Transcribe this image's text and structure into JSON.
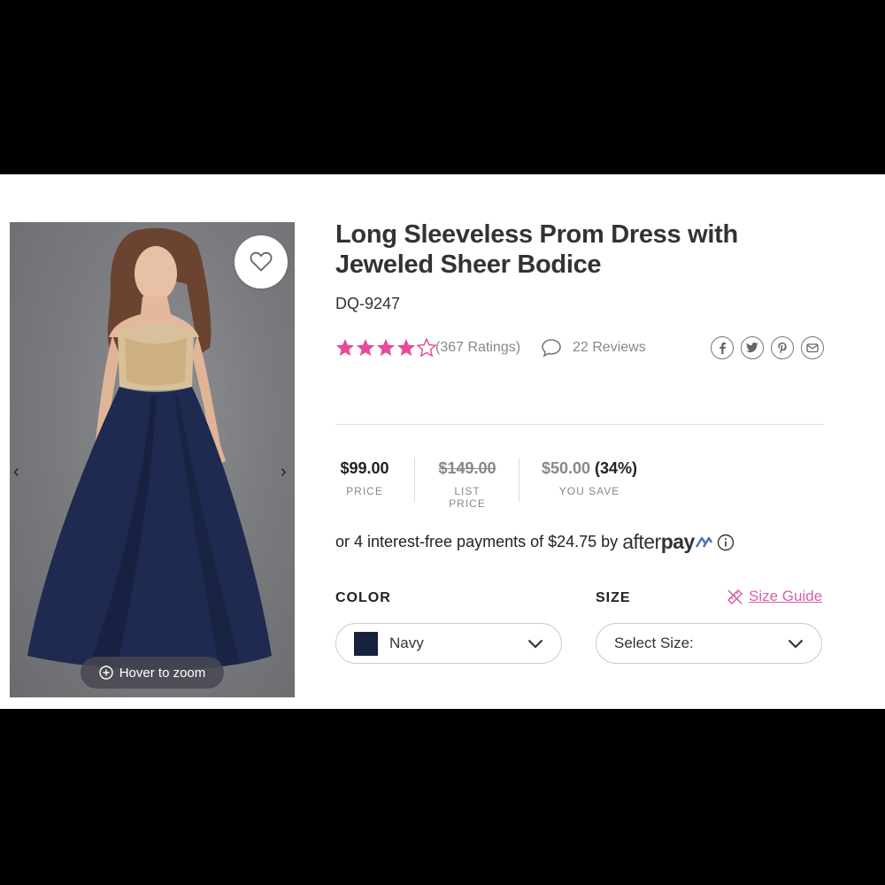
{
  "product": {
    "title": "Long Sleeveless Prom Dress with Jeweled Sheer Bodice",
    "sku": "DQ-9247",
    "rating": 4,
    "ratings_text": "(367 Ratings)",
    "reviews_text": "22 Reviews"
  },
  "gallery": {
    "zoom_label": "Hover to zoom",
    "prev_glyph": "‹",
    "next_glyph": "›"
  },
  "share": [
    "facebook-icon",
    "twitter-icon",
    "pinterest-icon",
    "email-icon"
  ],
  "pricing": {
    "price": "$99.00",
    "price_label": "PRICE",
    "list_price": "$149.00",
    "list_label": "LIST PRICE",
    "save_amount": "$50.00",
    "save_percent": "(34%)",
    "save_label": "YOU SAVE"
  },
  "afterpay": {
    "text": "or 4 interest-free payments of $24.75 by",
    "logo_prefix": "after",
    "logo_suffix": "pay"
  },
  "options": {
    "color_label": "COLOR",
    "color_value": "Navy",
    "color_hex": "#17223f",
    "size_label": "SIZE",
    "size_value": "Select Size:",
    "size_guide": "Size Guide"
  },
  "colors": {
    "star": "#e64b9a",
    "accent_pink": "#d65fa8",
    "text": "#333333"
  }
}
